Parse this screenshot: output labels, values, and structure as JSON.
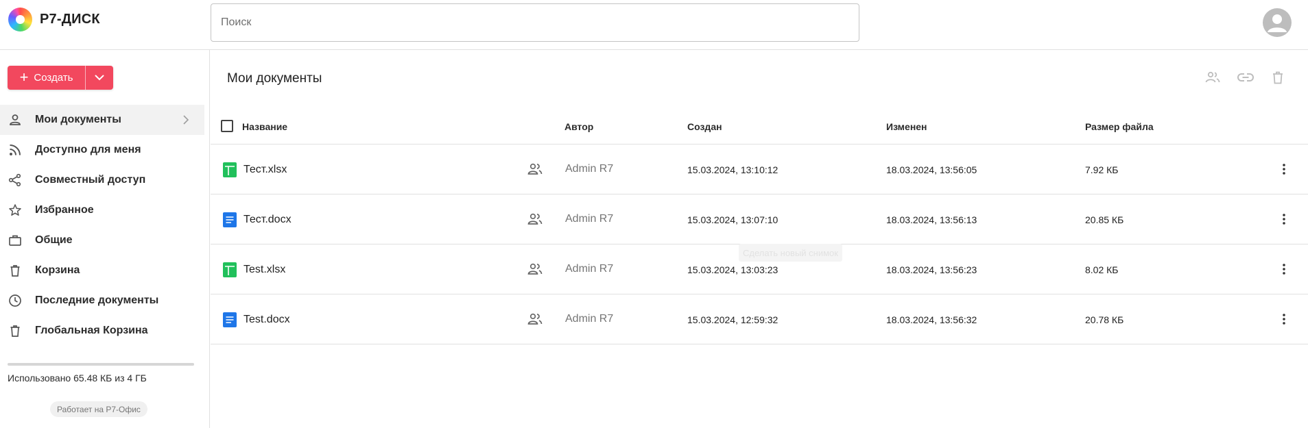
{
  "header": {
    "brand": "Р7-ДИСК",
    "search_placeholder": "Поиск"
  },
  "sidebar": {
    "create_label": "Создать",
    "items": [
      {
        "label": "Мои документы",
        "icon": "person-icon",
        "active": true
      },
      {
        "label": "Доступно для меня",
        "icon": "rss-icon"
      },
      {
        "label": "Совместный доступ",
        "icon": "share-icon"
      },
      {
        "label": "Избранное",
        "icon": "star-icon"
      },
      {
        "label": "Общие",
        "icon": "briefcase-icon"
      },
      {
        "label": "Корзина",
        "icon": "trash-icon"
      },
      {
        "label": "Последние документы",
        "icon": "clock-icon"
      },
      {
        "label": "Глобальная Корзина",
        "icon": "trash-icon"
      }
    ],
    "storage_used_fraction": 2e-05,
    "storage_text": "Использовано 65.48 КБ из 4 ГБ",
    "powered_by": "Работает на Р7-Офис"
  },
  "main": {
    "title": "Мои документы",
    "columns": {
      "name": "Название",
      "author": "Автор",
      "created": "Создан",
      "modified": "Изменен",
      "size": "Размер файла"
    },
    "rows": [
      {
        "name": "Тест.xlsx",
        "type": "xlsx",
        "author": "Admin R7",
        "created": "15.03.2024, 13:10:12",
        "modified": "18.03.2024, 13:56:05",
        "size": "7.92 КБ"
      },
      {
        "name": "Тест.docx",
        "type": "docx",
        "author": "Admin R7",
        "created": "15.03.2024, 13:07:10",
        "modified": "18.03.2024, 13:56:13",
        "size": "20.85 КБ"
      },
      {
        "name": "Test.xlsx",
        "type": "xlsx",
        "author": "Admin R7",
        "created": "15.03.2024, 13:03:23",
        "modified": "18.03.2024, 13:56:23",
        "size": "8.02 КБ"
      },
      {
        "name": "Test.docx",
        "type": "docx",
        "author": "Admin R7",
        "created": "15.03.2024, 12:59:32",
        "modified": "18.03.2024, 13:56:32",
        "size": "20.78 КБ"
      }
    ]
  },
  "overlay": {
    "tooltip": "Сделать новый снимок"
  },
  "colors": {
    "accent": "#f2485e",
    "xlsx": "#21c05b",
    "docx": "#1e76e8"
  }
}
